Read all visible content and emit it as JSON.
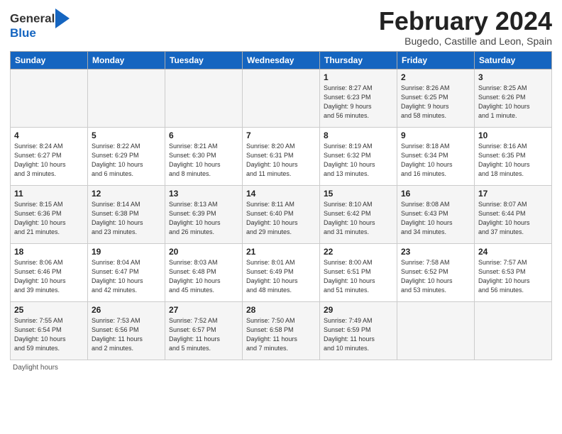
{
  "logo": {
    "general": "General",
    "blue": "Blue"
  },
  "title": {
    "month_year": "February 2024",
    "location": "Bugedo, Castille and Leon, Spain"
  },
  "days_of_week": [
    "Sunday",
    "Monday",
    "Tuesday",
    "Wednesday",
    "Thursday",
    "Friday",
    "Saturday"
  ],
  "weeks": [
    [
      {
        "num": "",
        "info": ""
      },
      {
        "num": "",
        "info": ""
      },
      {
        "num": "",
        "info": ""
      },
      {
        "num": "",
        "info": ""
      },
      {
        "num": "1",
        "info": "Sunrise: 8:27 AM\nSunset: 6:23 PM\nDaylight: 9 hours\nand 56 minutes."
      },
      {
        "num": "2",
        "info": "Sunrise: 8:26 AM\nSunset: 6:25 PM\nDaylight: 9 hours\nand 58 minutes."
      },
      {
        "num": "3",
        "info": "Sunrise: 8:25 AM\nSunset: 6:26 PM\nDaylight: 10 hours\nand 1 minute."
      }
    ],
    [
      {
        "num": "4",
        "info": "Sunrise: 8:24 AM\nSunset: 6:27 PM\nDaylight: 10 hours\nand 3 minutes."
      },
      {
        "num": "5",
        "info": "Sunrise: 8:22 AM\nSunset: 6:29 PM\nDaylight: 10 hours\nand 6 minutes."
      },
      {
        "num": "6",
        "info": "Sunrise: 8:21 AM\nSunset: 6:30 PM\nDaylight: 10 hours\nand 8 minutes."
      },
      {
        "num": "7",
        "info": "Sunrise: 8:20 AM\nSunset: 6:31 PM\nDaylight: 10 hours\nand 11 minutes."
      },
      {
        "num": "8",
        "info": "Sunrise: 8:19 AM\nSunset: 6:32 PM\nDaylight: 10 hours\nand 13 minutes."
      },
      {
        "num": "9",
        "info": "Sunrise: 8:18 AM\nSunset: 6:34 PM\nDaylight: 10 hours\nand 16 minutes."
      },
      {
        "num": "10",
        "info": "Sunrise: 8:16 AM\nSunset: 6:35 PM\nDaylight: 10 hours\nand 18 minutes."
      }
    ],
    [
      {
        "num": "11",
        "info": "Sunrise: 8:15 AM\nSunset: 6:36 PM\nDaylight: 10 hours\nand 21 minutes."
      },
      {
        "num": "12",
        "info": "Sunrise: 8:14 AM\nSunset: 6:38 PM\nDaylight: 10 hours\nand 23 minutes."
      },
      {
        "num": "13",
        "info": "Sunrise: 8:13 AM\nSunset: 6:39 PM\nDaylight: 10 hours\nand 26 minutes."
      },
      {
        "num": "14",
        "info": "Sunrise: 8:11 AM\nSunset: 6:40 PM\nDaylight: 10 hours\nand 29 minutes."
      },
      {
        "num": "15",
        "info": "Sunrise: 8:10 AM\nSunset: 6:42 PM\nDaylight: 10 hours\nand 31 minutes."
      },
      {
        "num": "16",
        "info": "Sunrise: 8:08 AM\nSunset: 6:43 PM\nDaylight: 10 hours\nand 34 minutes."
      },
      {
        "num": "17",
        "info": "Sunrise: 8:07 AM\nSunset: 6:44 PM\nDaylight: 10 hours\nand 37 minutes."
      }
    ],
    [
      {
        "num": "18",
        "info": "Sunrise: 8:06 AM\nSunset: 6:46 PM\nDaylight: 10 hours\nand 39 minutes."
      },
      {
        "num": "19",
        "info": "Sunrise: 8:04 AM\nSunset: 6:47 PM\nDaylight: 10 hours\nand 42 minutes."
      },
      {
        "num": "20",
        "info": "Sunrise: 8:03 AM\nSunset: 6:48 PM\nDaylight: 10 hours\nand 45 minutes."
      },
      {
        "num": "21",
        "info": "Sunrise: 8:01 AM\nSunset: 6:49 PM\nDaylight: 10 hours\nand 48 minutes."
      },
      {
        "num": "22",
        "info": "Sunrise: 8:00 AM\nSunset: 6:51 PM\nDaylight: 10 hours\nand 51 minutes."
      },
      {
        "num": "23",
        "info": "Sunrise: 7:58 AM\nSunset: 6:52 PM\nDaylight: 10 hours\nand 53 minutes."
      },
      {
        "num": "24",
        "info": "Sunrise: 7:57 AM\nSunset: 6:53 PM\nDaylight: 10 hours\nand 56 minutes."
      }
    ],
    [
      {
        "num": "25",
        "info": "Sunrise: 7:55 AM\nSunset: 6:54 PM\nDaylight: 10 hours\nand 59 minutes."
      },
      {
        "num": "26",
        "info": "Sunrise: 7:53 AM\nSunset: 6:56 PM\nDaylight: 11 hours\nand 2 minutes."
      },
      {
        "num": "27",
        "info": "Sunrise: 7:52 AM\nSunset: 6:57 PM\nDaylight: 11 hours\nand 5 minutes."
      },
      {
        "num": "28",
        "info": "Sunrise: 7:50 AM\nSunset: 6:58 PM\nDaylight: 11 hours\nand 7 minutes."
      },
      {
        "num": "29",
        "info": "Sunrise: 7:49 AM\nSunset: 6:59 PM\nDaylight: 11 hours\nand 10 minutes."
      },
      {
        "num": "",
        "info": ""
      },
      {
        "num": "",
        "info": ""
      }
    ]
  ],
  "footer": {
    "label": "Daylight hours"
  }
}
